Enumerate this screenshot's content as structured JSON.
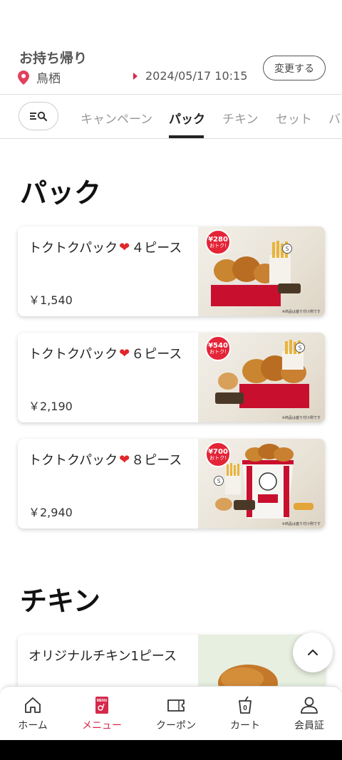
{
  "header": {
    "order_type": "お持ち帰り",
    "store": "鳥栖",
    "datetime": "2024/05/17 10:15",
    "change_label": "変更する"
  },
  "tabs": [
    {
      "label": "キャンペーン"
    },
    {
      "label": "パック"
    },
    {
      "label": "チキン"
    },
    {
      "label": "セット"
    },
    {
      "label": "バ"
    }
  ],
  "active_tab": "パック",
  "sections": [
    {
      "title": "パック",
      "items": [
        {
          "name_prefix": "トクトクパック",
          "name_suffix": "４ピース",
          "price": "￥1,540",
          "badge_amount": "¥280",
          "badge_sub": "おトク!"
        },
        {
          "name_prefix": "トクトクパック",
          "name_suffix": "６ピース",
          "price": "￥2,190",
          "badge_amount": "¥540",
          "badge_sub": "おトク!"
        },
        {
          "name_prefix": "トクトクパック",
          "name_suffix": "８ピース",
          "price": "￥2,940",
          "badge_amount": "¥700",
          "badge_sub": "おトク!"
        }
      ]
    },
    {
      "title": "チキン",
      "items": [
        {
          "name": "オリジナルチキン1ピース"
        }
      ]
    }
  ],
  "image_note": "※商品は盛り付け例です",
  "bottom_nav": [
    {
      "label": "ホーム",
      "icon": "home-icon"
    },
    {
      "label": "メニュー",
      "icon": "menu-icon"
    },
    {
      "label": "クーポン",
      "icon": "coupon-icon"
    },
    {
      "label": "カート",
      "icon": "cart-icon"
    },
    {
      "label": "会員証",
      "icon": "member-icon"
    }
  ],
  "cart_count": "0",
  "colors": {
    "accent": "#d4294b",
    "badge": "#e42437"
  }
}
